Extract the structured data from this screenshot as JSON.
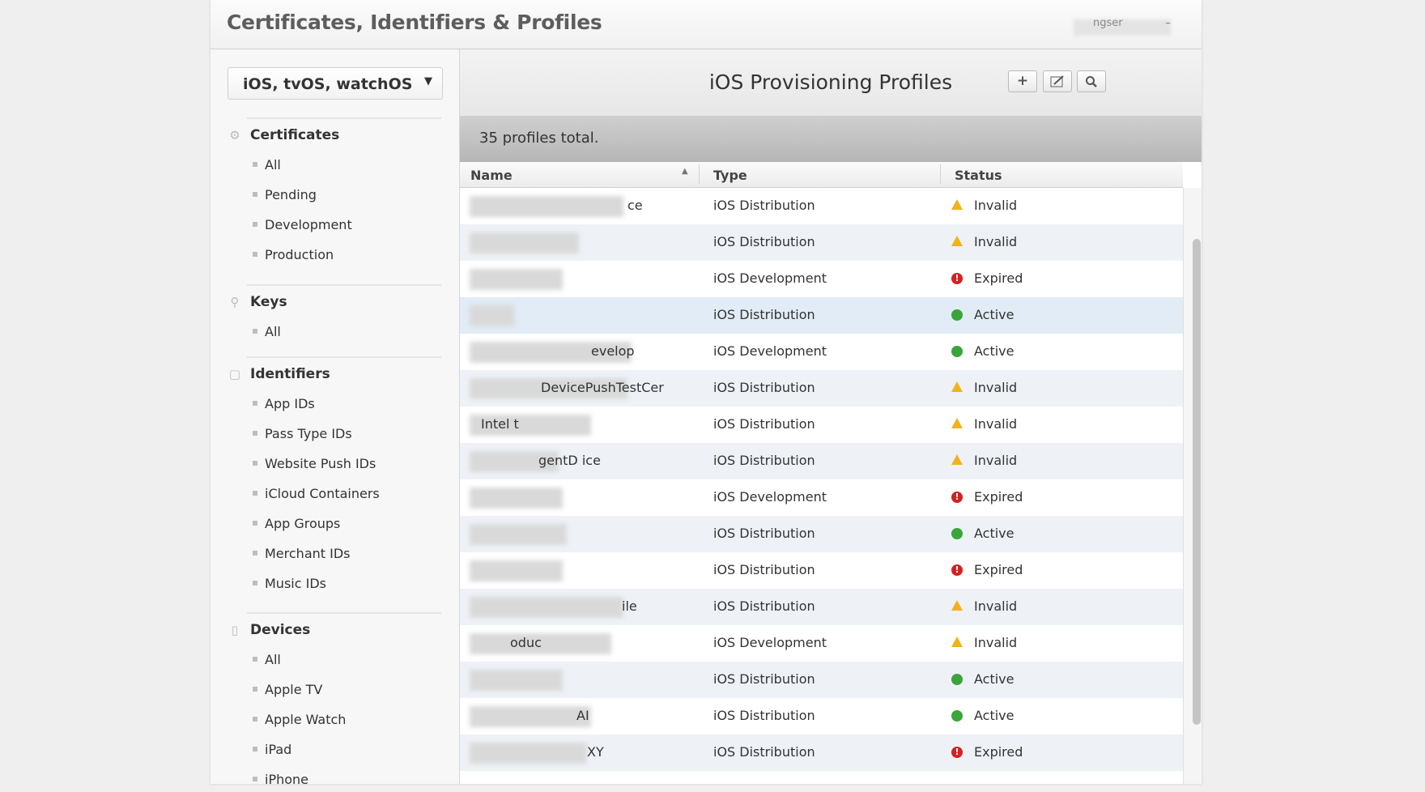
{
  "header": {
    "title": "Certificates, Identifiers & Profiles",
    "user_fragment": "ngser"
  },
  "sidebar": {
    "platform_select": "iOS, tvOS, watchOS",
    "sections": [
      {
        "title": "Certificates",
        "icon": "certificate-icon",
        "items": [
          "All",
          "Pending",
          "Development",
          "Production"
        ]
      },
      {
        "title": "Keys",
        "icon": "key-icon",
        "items": [
          "All"
        ]
      },
      {
        "title": "Identifiers",
        "icon": "id-icon",
        "items": [
          "App IDs",
          "Pass Type IDs",
          "Website Push IDs",
          "iCloud Containers",
          "App Groups",
          "Merchant IDs",
          "Music IDs"
        ]
      },
      {
        "title": "Devices",
        "icon": "device-icon",
        "items": [
          "All",
          "Apple TV",
          "Apple Watch",
          "iPad",
          "iPhone"
        ]
      }
    ]
  },
  "main": {
    "title": "iOS Provisioning Profiles",
    "toolbar": {
      "add_icon": "plus-icon",
      "edit_icon": "edit-icon",
      "search_icon": "search-icon"
    },
    "summary": "35 profiles total.",
    "columns": [
      "Name",
      "Type",
      "Status"
    ],
    "rows": [
      {
        "name": "ce",
        "type": "iOS Distribution",
        "status": "Invalid"
      },
      {
        "name": "",
        "type": "iOS Distribution",
        "status": "Invalid"
      },
      {
        "name": "",
        "type": "iOS Development",
        "status": "Expired"
      },
      {
        "name": "",
        "type": "iOS Distribution",
        "status": "Active"
      },
      {
        "name": "evelop",
        "type": "iOS Development",
        "status": "Active"
      },
      {
        "name": "DevicePushTestCer",
        "type": "iOS Distribution",
        "status": "Invalid"
      },
      {
        "name": "Intel                      t",
        "type": "iOS Distribution",
        "status": "Invalid"
      },
      {
        "name": "gentD   ice",
        "type": "iOS Distribution",
        "status": "Invalid"
      },
      {
        "name": "",
        "type": "iOS Development",
        "status": "Expired"
      },
      {
        "name": "",
        "type": "iOS Distribution",
        "status": "Active"
      },
      {
        "name": "",
        "type": "iOS Distribution",
        "status": "Expired"
      },
      {
        "name": "ile",
        "type": "iOS Distribution",
        "status": "Invalid"
      },
      {
        "name": "oduc",
        "type": "iOS Development",
        "status": "Invalid"
      },
      {
        "name": "",
        "type": "iOS Distribution",
        "status": "Active"
      },
      {
        "name": "AI",
        "type": "iOS Distribution",
        "status": "Active"
      },
      {
        "name": "XY",
        "type": "iOS Distribution",
        "status": "Expired"
      }
    ]
  },
  "colors": {
    "active": "#3aa53a",
    "expired": "#d42121",
    "invalid": "#f1b21b"
  }
}
